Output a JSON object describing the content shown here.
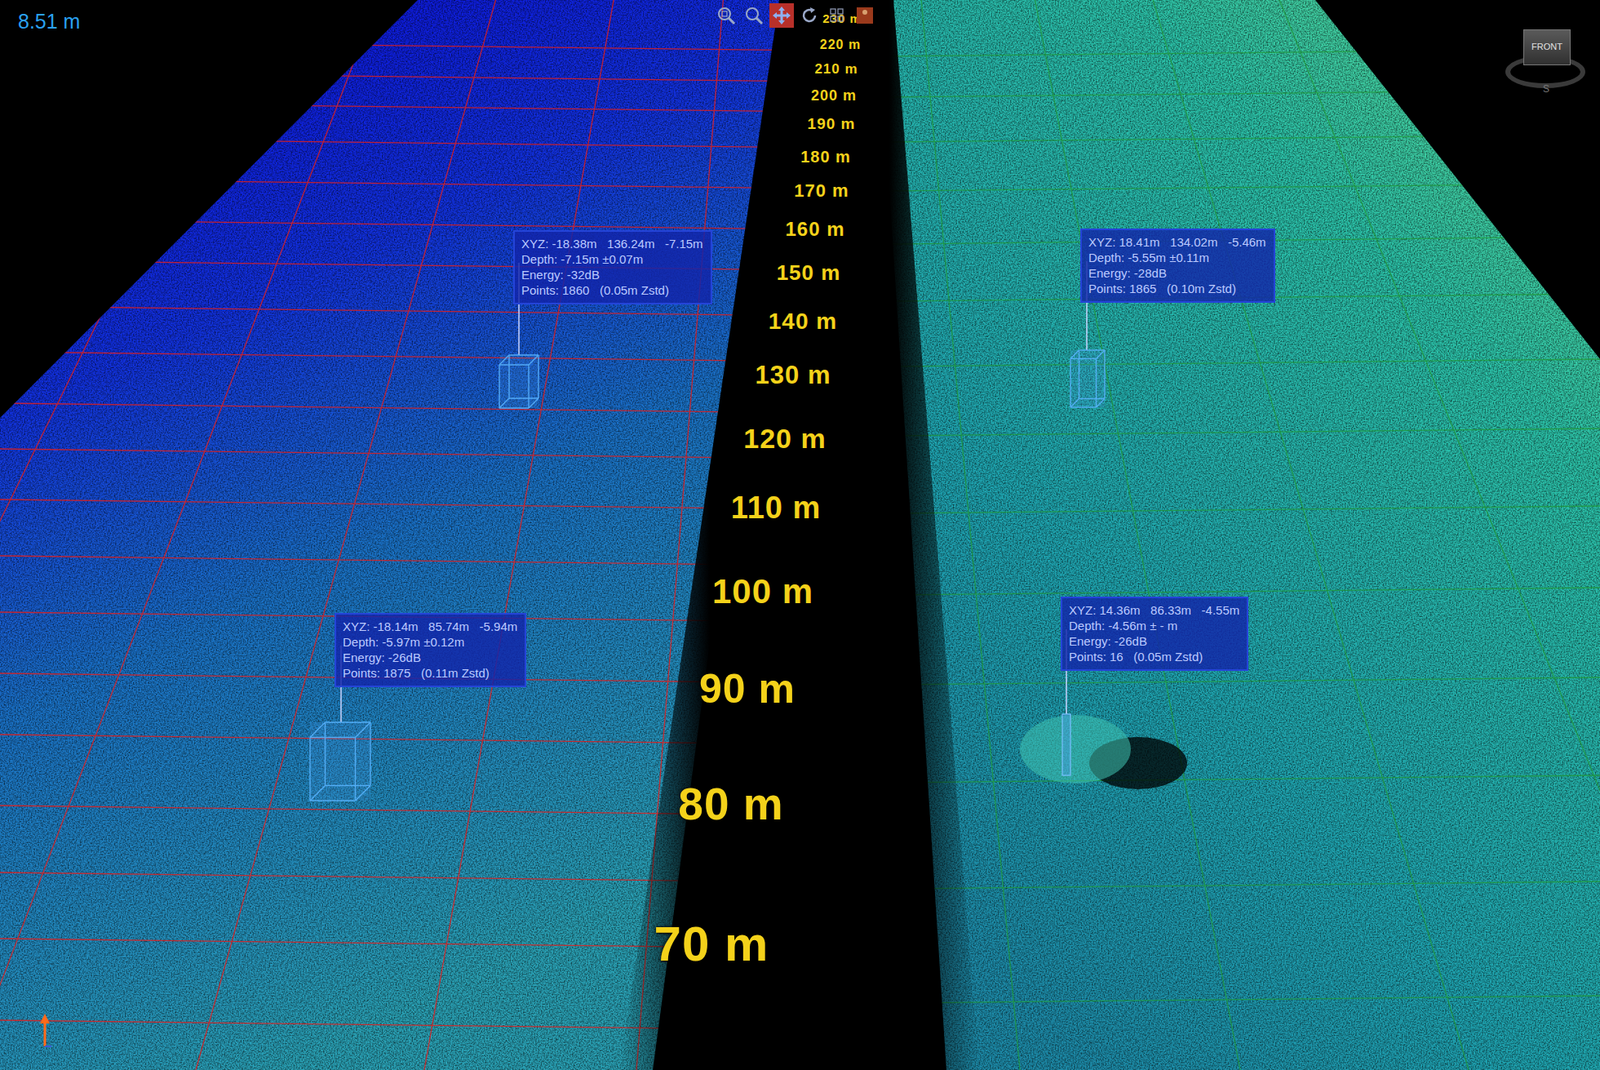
{
  "viewer": {
    "scale_label": "8.51 m"
  },
  "toolbar": [
    {
      "kind": "zoom-window",
      "selected": false
    },
    {
      "kind": "zoom",
      "selected": false
    },
    {
      "kind": "pan",
      "selected": true
    },
    {
      "kind": "rotate",
      "selected": false
    },
    {
      "kind": "fit",
      "selected": false
    },
    {
      "kind": "settings",
      "selected": false
    }
  ],
  "range_labels": [
    "230 m",
    "220 m",
    "210 m",
    "200 m",
    "190 m",
    "180 m",
    "170 m",
    "160 m",
    "150 m",
    "140 m",
    "130 m",
    "120 m",
    "110 m",
    "100 m",
    "90 m",
    "80 m",
    "70 m"
  ],
  "markers": [
    {
      "kind": "box",
      "xyz": "XYZ: -18.38m   136.24m   -7.15m",
      "depth": "Depth: -7.15m ±0.07m",
      "energy": "Energy: -32dB",
      "points": "Points: 1860   (0.05m Zstd)"
    },
    {
      "kind": "box",
      "xyz": "XYZ: 18.41m   134.02m   -5.46m",
      "depth": "Depth: -5.55m ±0.11m",
      "energy": "Energy: -28dB",
      "points": "Points: 1865   (0.10m Zstd)"
    },
    {
      "kind": "box",
      "xyz": "XYZ: -18.14m   85.74m   -5.94m",
      "depth": "Depth: -5.97m ±0.12m",
      "energy": "Energy: -26dB",
      "points": "Points: 1875   (0.11m Zstd)"
    },
    {
      "kind": "pole",
      "xyz": "XYZ: 14.36m   86.33m   -4.55m",
      "depth": "Depth: -4.56m ± - m",
      "energy": "Energy: -26dB",
      "points": "Points: 16   (0.05m Zstd)"
    }
  ],
  "view_cube": {
    "face": "FRONT",
    "heading": "S"
  }
}
